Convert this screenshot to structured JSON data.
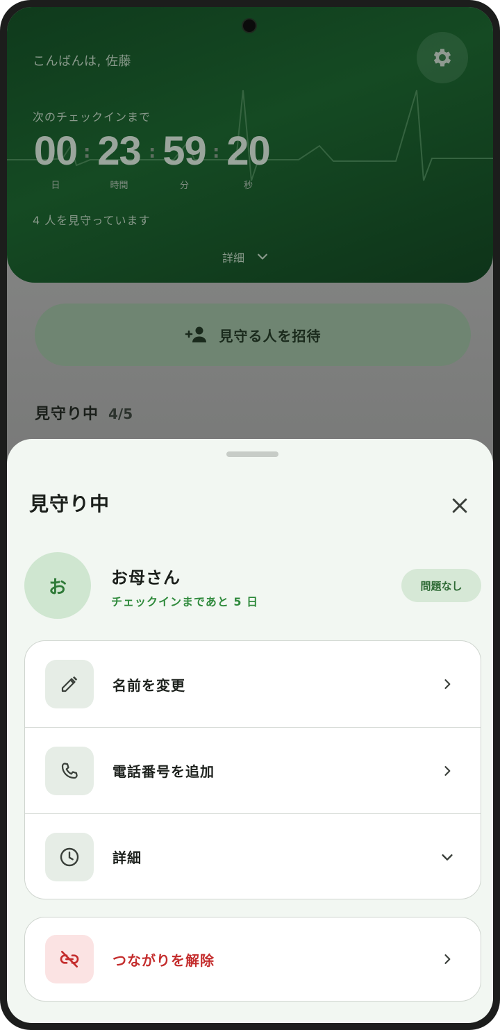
{
  "background": {
    "greeting": "こんばんは, 佐藤",
    "next_checkin_label": "次のチェックインまで",
    "countdown": [
      {
        "value": "00",
        "unit": "日"
      },
      {
        "value": "23",
        "unit": "時間"
      },
      {
        "value": "59",
        "unit": "分"
      },
      {
        "value": "20",
        "unit": "秒"
      }
    ],
    "watching_text": "4 人を見守っています",
    "details_toggle": "詳細",
    "invite_button": "見守る人を招待",
    "section_title": "見守り中",
    "section_count": "4/5",
    "icons": [
      "gear-icon",
      "chevron-down-icon",
      "person-add-icon"
    ]
  },
  "sheet": {
    "title": "見守り中",
    "person": {
      "avatar_initial": "お",
      "name": "お母さん",
      "subtitle": "チェックインまであと 5 日",
      "status": "問題なし"
    },
    "rows": [
      {
        "label": "名前を変更",
        "icon": "pencil-icon",
        "trailing": "chevron-right-icon"
      },
      {
        "label": "電話番号を追加",
        "icon": "phone-icon",
        "trailing": "chevron-right-icon"
      },
      {
        "label": "詳細",
        "icon": "clock-icon",
        "trailing": "chevron-down-icon"
      }
    ],
    "danger_row": {
      "label": "つながりを解除",
      "icon": "link-off-icon",
      "trailing": "chevron-right-icon"
    }
  },
  "colors": {
    "hero_green": "#154a23",
    "accent_green": "#2f8a3c",
    "danger_red": "#c42d2d",
    "sheet_bg": "#f2f7f2"
  }
}
